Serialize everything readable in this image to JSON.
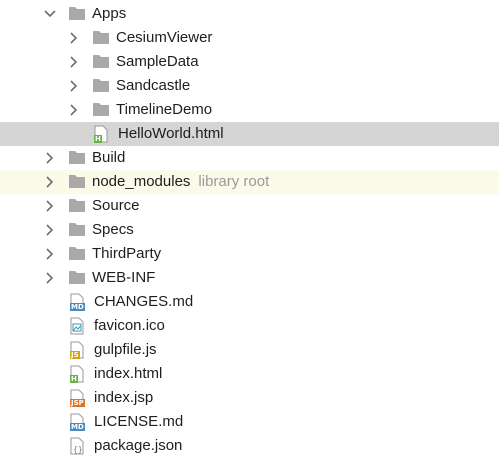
{
  "tree": {
    "apps_folder": "Apps",
    "apps_children": {
      "cesium_viewer": "CesiumViewer",
      "sample_data": "SampleData",
      "sandcastle": "Sandcastle",
      "timeline_demo": "TimelineDemo",
      "hello_world": "HelloWorld.html"
    },
    "build_folder": "Build",
    "node_modules_folder": "node_modules",
    "node_modules_hint": "library root",
    "source_folder": "Source",
    "specs_folder": "Specs",
    "thirdparty_folder": "ThirdParty",
    "webinf_folder": "WEB-INF",
    "files": {
      "changes": "CHANGES.md",
      "favicon": "favicon.ico",
      "gulpfile": "gulpfile.js",
      "index_html": "index.html",
      "index_jsp": "index.jsp",
      "license": "LICENSE.md",
      "package": "package.json"
    },
    "badges": {
      "md": "MD",
      "html": "H",
      "js": "JS",
      "jsp": "JSP"
    },
    "colors": {
      "folder": "#a9a9a9",
      "selected_bg": "#d5d5d5",
      "library_bg": "#fcfae9",
      "html_badge": "#62b543",
      "md_badge": "#4a8bbf",
      "js_badge": "#d6a21b",
      "jsp_badge": "#e0732a"
    }
  }
}
